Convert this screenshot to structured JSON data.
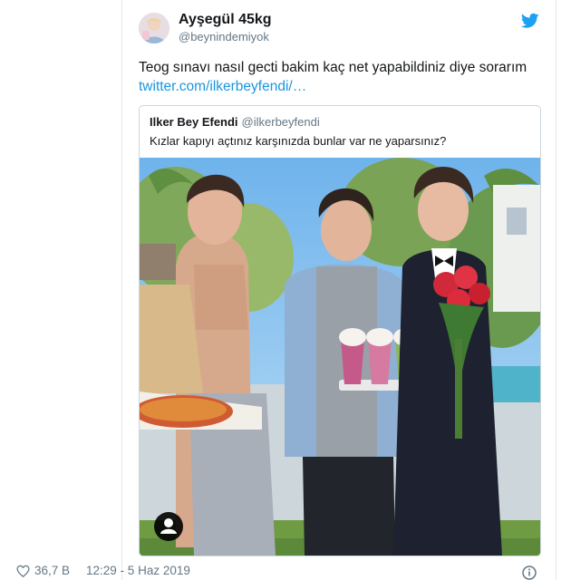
{
  "tweet": {
    "author_name": "Ayşegül 45kg",
    "author_handle": "@beynindemiyok",
    "text": "Teog sınavı nasıl gecti bakim kaç net yapabildiniz diye sorarım",
    "link": "twitter.com/ilkerbeyfendi/…",
    "likes": "36,7 B",
    "time": "12:29 - 5 Haz 2019",
    "icons": {
      "brand": "twitter-bird-icon",
      "like": "heart-icon",
      "info": "info-icon"
    },
    "colors": {
      "link": "#1b95e0",
      "brand": "#1da1f2",
      "muted": "#657786"
    }
  },
  "quote": {
    "author_name": "Ilker Bey Efendi",
    "author_handle": "@ilkerbeyfendi",
    "text": "Kızlar kapıyı açtınız karşınızda bunlar var ne yaparsınız?"
  }
}
